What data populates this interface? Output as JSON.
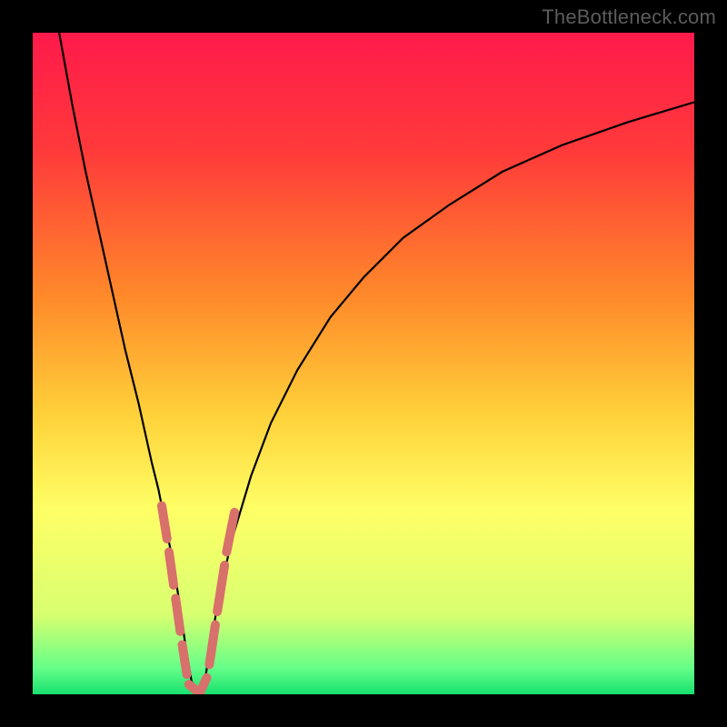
{
  "watermark": "TheBottleneck.com",
  "chart_data": {
    "type": "line",
    "title": "",
    "xlabel": "",
    "ylabel": "",
    "xlim": [
      0,
      100
    ],
    "ylim": [
      0,
      100
    ],
    "gradient_stops": [
      {
        "offset": 0,
        "color": "#ff1a4b"
      },
      {
        "offset": 18,
        "color": "#ff3a3a"
      },
      {
        "offset": 40,
        "color": "#ff8a2a"
      },
      {
        "offset": 58,
        "color": "#ffd23a"
      },
      {
        "offset": 72,
        "color": "#ffff66"
      },
      {
        "offset": 88,
        "color": "#d8ff70"
      },
      {
        "offset": 96,
        "color": "#66ff88"
      },
      {
        "offset": 100,
        "color": "#18e070"
      }
    ],
    "series": [
      {
        "name": "bottleneck-curve",
        "color": "#000000",
        "x": [
          4,
          6,
          8,
          10,
          12,
          14,
          16,
          18,
          19,
          20,
          21,
          22,
          23,
          24,
          25,
          26,
          27,
          28,
          30,
          33,
          36,
          40,
          45,
          50,
          56,
          63,
          71,
          80,
          90,
          100
        ],
        "y": [
          100,
          89,
          79,
          70,
          61,
          52,
          44,
          35,
          31,
          26,
          21,
          15,
          8,
          2,
          0.5,
          2,
          8,
          14,
          23,
          33,
          41,
          49,
          57,
          63,
          69,
          74,
          79,
          83,
          86.5,
          89.5
        ]
      }
    ],
    "highlight_segments": {
      "name": "pink-markers",
      "color": "#d8706b",
      "linewidth": 10,
      "points": [
        {
          "x1": 19.5,
          "y1": 28.5,
          "x2": 20.3,
          "y2": 23.5
        },
        {
          "x1": 20.6,
          "y1": 21.5,
          "x2": 21.3,
          "y2": 16.5
        },
        {
          "x1": 21.6,
          "y1": 14.5,
          "x2": 22.3,
          "y2": 9.5
        },
        {
          "x1": 22.6,
          "y1": 7.5,
          "x2": 23.3,
          "y2": 3.0
        },
        {
          "x1": 23.6,
          "y1": 1.5,
          "x2": 25.0,
          "y2": 0.3
        },
        {
          "x1": 25.3,
          "y1": 0.3,
          "x2": 26.3,
          "y2": 2.5
        },
        {
          "x1": 26.7,
          "y1": 4.5,
          "x2": 27.6,
          "y2": 10.5
        },
        {
          "x1": 27.9,
          "y1": 12.5,
          "x2": 29.0,
          "y2": 19.5
        },
        {
          "x1": 29.3,
          "y1": 21.5,
          "x2": 30.5,
          "y2": 27.5
        }
      ]
    }
  }
}
